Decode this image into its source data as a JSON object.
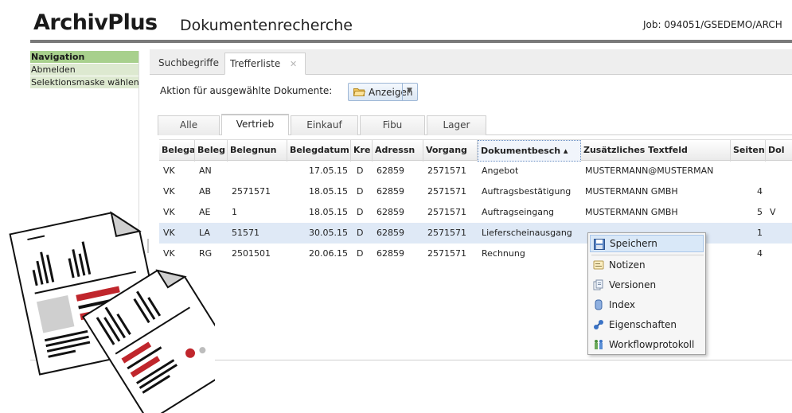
{
  "header": {
    "logo": "ArchivPlus",
    "title": "Dokumentenrecherche",
    "job": "Job: 094051/GSEDEMO/ARCH"
  },
  "nav": {
    "heading": "Navigation",
    "items": [
      {
        "label": "Abmelden"
      },
      {
        "label": "Selektionsmaske wählen"
      }
    ]
  },
  "tabs": [
    {
      "label": "Suchbegriffe"
    },
    {
      "label": "Trefferliste",
      "close": "✕"
    }
  ],
  "toolbar": {
    "action_label": "Aktion für ausgewählte Dokumente:",
    "button_label": "Anzeigen"
  },
  "subtabs": [
    {
      "label": "Alle"
    },
    {
      "label": "Vertrieb"
    },
    {
      "label": "Einkauf"
    },
    {
      "label": "Fibu"
    },
    {
      "label": "Lager"
    }
  ],
  "grid": {
    "columns": [
      "Belegart",
      "Belegtyp",
      "Belegnummer",
      "Belegdatum",
      "Kre",
      "Adressnummer",
      "Vorgang",
      "Dokumentbeschreibung",
      "Zusätzliches Textfeld",
      "Seitenanzahl",
      "Dok"
    ],
    "columns_display": [
      "Belega",
      "Beleg",
      "Belegnun",
      "Belegdatum",
      "Kre",
      "Adressn",
      "Vorgang",
      "Dokumentbesch ▴",
      "Zusätzliches Textfeld",
      "Seiten",
      "Dol"
    ],
    "rows": [
      [
        "VK",
        "AN",
        "",
        "17.05.15",
        "D",
        "62859",
        "2571571",
        "Angebot",
        "MUSTERMANN@MUSTERMAN",
        "",
        ""
      ],
      [
        "VK",
        "AB",
        "2571571",
        "18.05.15",
        "D",
        "62859",
        "2571571",
        "Auftragsbestätigung",
        "MUSTERMANN GMBH",
        "4",
        ""
      ],
      [
        "VK",
        "AE",
        "1",
        "18.05.15",
        "D",
        "62859",
        "2571571",
        "Auftragseingang",
        "MUSTERMANN GMBH",
        "5",
        "V"
      ],
      [
        "VK",
        "LA",
        "51571",
        "30.05.15",
        "D",
        "62859",
        "2571571",
        "Lieferscheinausgang",
        "",
        "1",
        ""
      ],
      [
        "VK",
        "RG",
        "2501501",
        "20.06.15",
        "D",
        "62859",
        "2571571",
        "Rechnung",
        "",
        "4",
        ""
      ]
    ],
    "selected_row": 3
  },
  "context_menu": {
    "items": [
      {
        "label": "Speichern",
        "icon": "floppy-disk-icon"
      },
      {
        "label": "Notizen",
        "icon": "note-icon"
      },
      {
        "label": "Versionen",
        "icon": "versions-icon"
      },
      {
        "label": "Index",
        "icon": "index-icon"
      },
      {
        "label": "Eigenschaften",
        "icon": "properties-icon"
      },
      {
        "label": "Workflowprotokoll",
        "icon": "workflow-icon"
      }
    ]
  },
  "colors": {
    "nav_heading": "#a8d08d",
    "nav_item": "#dde9d0",
    "selection": "#dfe9f6",
    "clipart_red": "#c0262c"
  }
}
